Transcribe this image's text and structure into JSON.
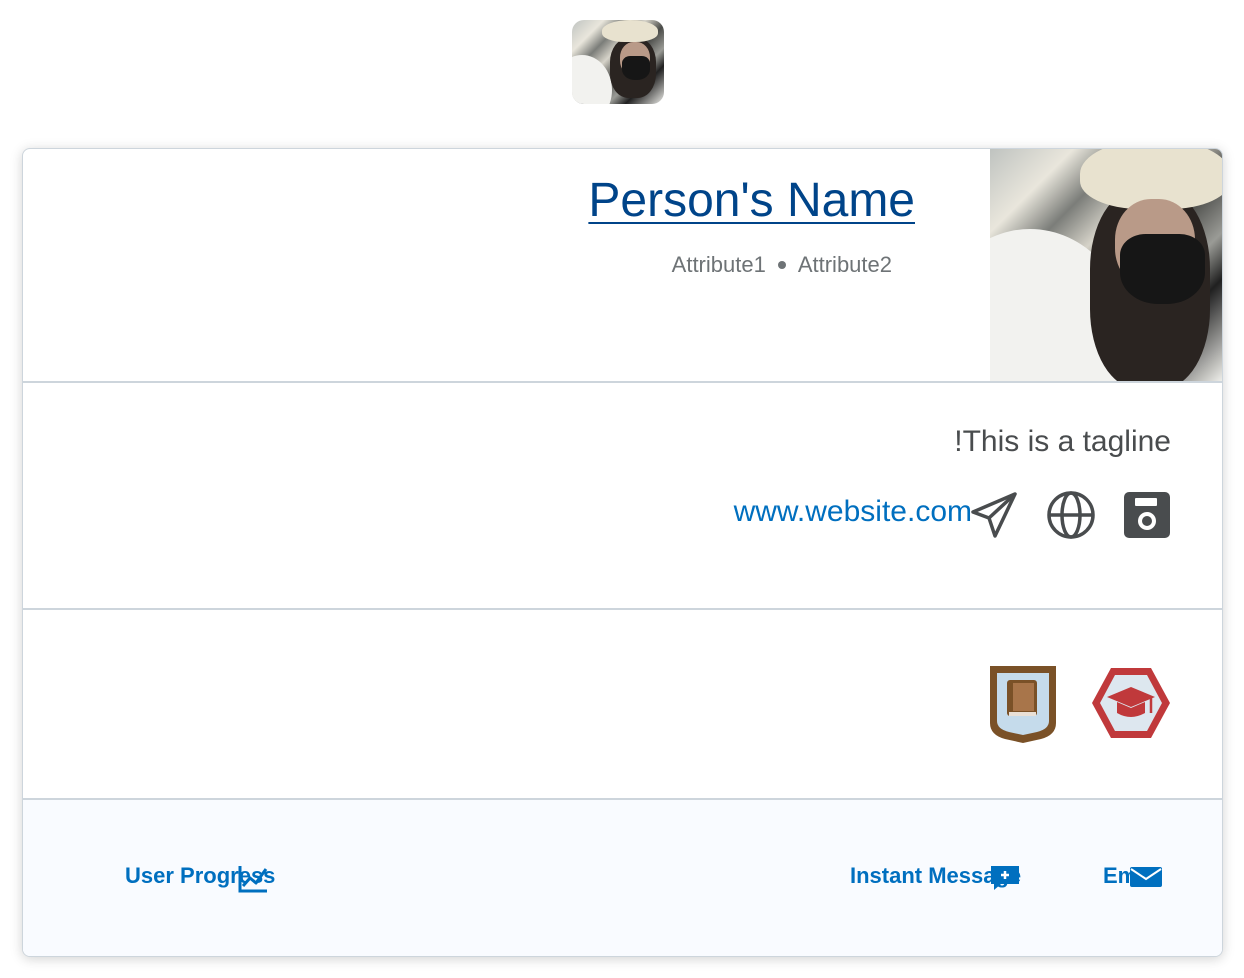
{
  "top_avatar": {
    "alt": "profile avatar"
  },
  "profile": {
    "name": "Person's Name",
    "attributes": [
      "Attribute1",
      "Attribute2"
    ]
  },
  "about": {
    "tagline": "This is a tagline!",
    "website": "www.website.com"
  },
  "social_icons": [
    "send-icon",
    "globe-icon",
    "save-icon"
  ],
  "badges": [
    {
      "icon": "book-shield-badge-icon",
      "color": "#7a5127"
    },
    {
      "icon": "graduation-cap-badge-icon",
      "color": "#c0393b"
    }
  ],
  "actions": {
    "user_progress": "User Progress",
    "instant_message": "Instant Message",
    "email": "Email"
  },
  "colors": {
    "link": "#006fbf",
    "name": "#004489",
    "text": "#494c4e",
    "border": "#cdd5dc",
    "footer_bg": "#f9fbff"
  }
}
